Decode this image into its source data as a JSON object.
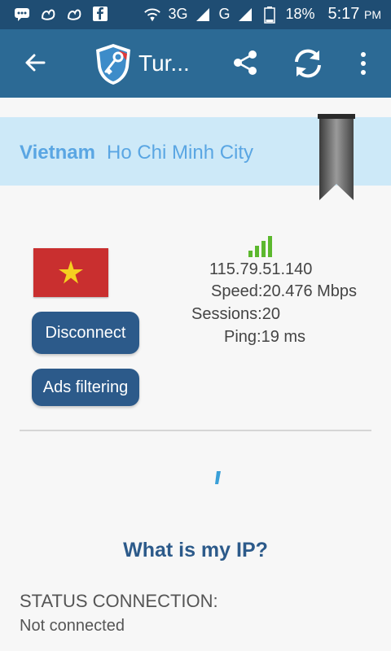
{
  "status_bar": {
    "network": "3G",
    "carrier": "G",
    "battery": "18%",
    "time": "5:17",
    "ampm": "PM",
    "icons": [
      "chat-icon",
      "uc-icon",
      "uc-icon",
      "facebook-icon"
    ]
  },
  "app_bar": {
    "title": "Tur...",
    "icons": [
      "back-arrow-icon",
      "shield-logo-icon",
      "share-icon",
      "sync-icon",
      "more-vert-icon"
    ]
  },
  "location": {
    "country": "Vietnam",
    "city": "Ho Chi Minh City"
  },
  "server": {
    "ip": "115.79.51.140",
    "speed": "Speed:20.476 Mbps",
    "sessions": "Sessions:20",
    "ping": "Ping:19 ms"
  },
  "buttons": {
    "disconnect": "Disconnect",
    "ads_filtering": "Ads filtering"
  },
  "what_is_ip": "What is my IP?",
  "status": {
    "label": "STATUS CONNECTION:",
    "value": "Not connected"
  },
  "colors": {
    "status_bar": "#1f4d73",
    "app_bar": "#2c6a95",
    "band": "#cde9f8",
    "location_text": "#5aa6e3",
    "button": "#2c5a8a",
    "signal": "#5cb82e"
  }
}
